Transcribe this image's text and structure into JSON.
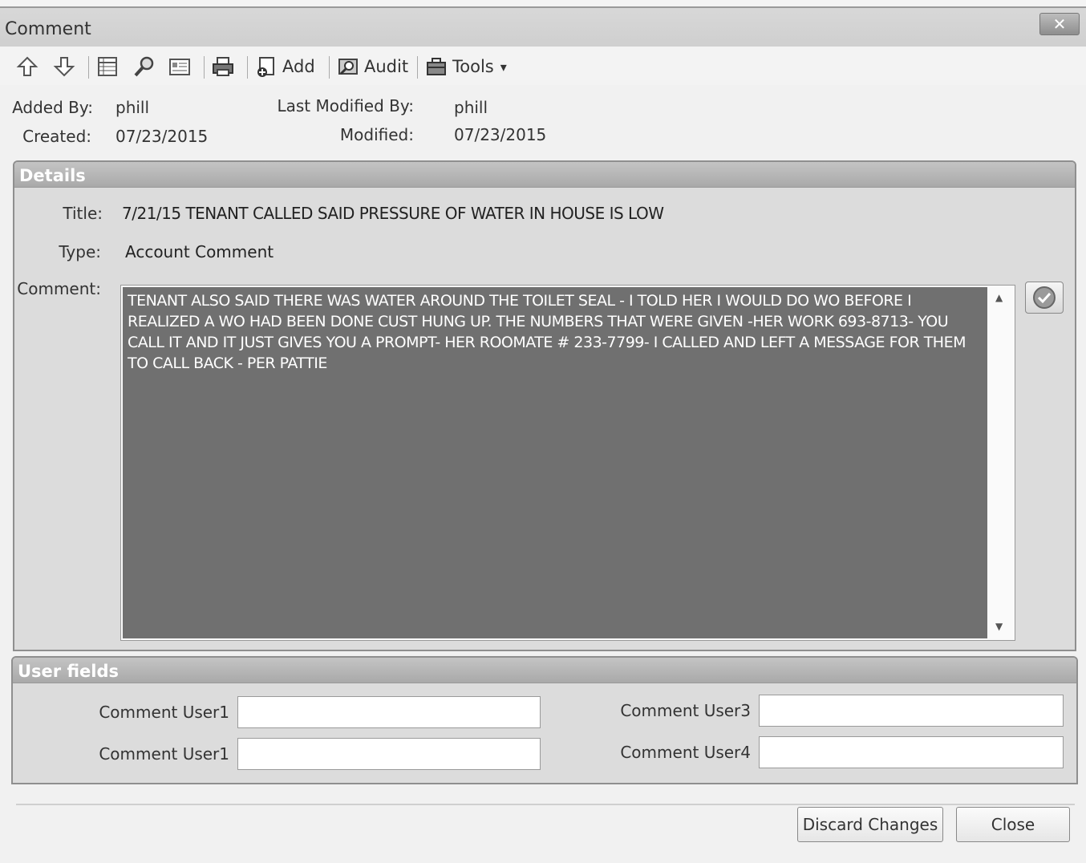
{
  "window": {
    "title": "Comment",
    "close_glyph": "✕"
  },
  "toolbar": {
    "add_label": "Add",
    "audit_label": "Audit",
    "tools_label": "Tools",
    "tools_caret": "▾"
  },
  "meta": {
    "added_by_label": "Added By:",
    "added_by_value": "phill",
    "created_label": "Created:",
    "created_value": "07/23/2015",
    "last_modified_by_label": "Last Modified By:",
    "last_modified_by_value": "phill",
    "modified_label": "Modified:",
    "modified_value": "07/23/2015"
  },
  "details": {
    "header": "Details",
    "title_label": "Title:",
    "title_value": "7/21/15 TENANT CALLED SAID PRESSURE OF WATER IN HOUSE IS LOW",
    "type_label": "Type:",
    "type_value": "Account Comment",
    "comment_label": "Comment:",
    "comment_value": "TENANT ALSO SAID THERE WAS WATER AROUND THE TOILET SEAL - I TOLD HER I WOULD DO WO BEFORE I REALIZED A WO HAD BEEN DONE CUST HUNG UP.  THE NUMBERS THAT WERE GIVEN -HER WORK 693-8713- YOU CALL IT AND IT JUST GIVES YOU A PROMPT- HER ROOMATE # 233-7799- I CALLED AND LEFT A MESSAGE FOR THEM TO CALL BACK - PER PATTIE"
  },
  "user_fields": {
    "header": "User fields",
    "user1_label": "Comment User1",
    "user2_label": "Comment User1",
    "user3_label": "Comment User3",
    "user4_label": "Comment User4",
    "user1_value": "",
    "user2_value": "",
    "user3_value": "",
    "user4_value": ""
  },
  "footer": {
    "discard_label": "Discard Changes",
    "close_label": "Close"
  }
}
